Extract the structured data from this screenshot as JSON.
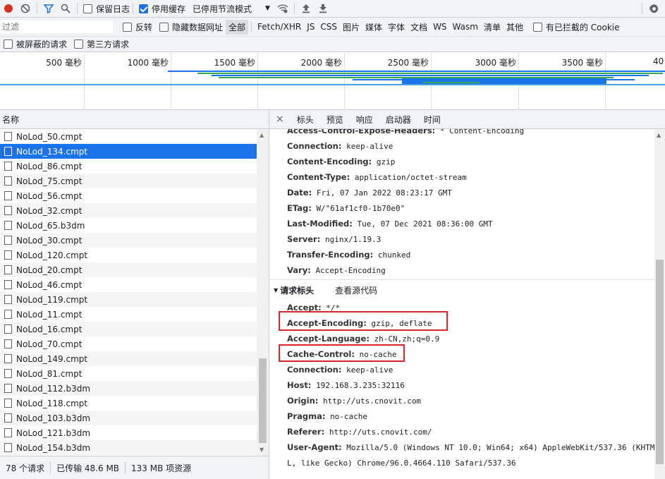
{
  "toolbar": {
    "preserve_log": "保留日志",
    "disable_cache": "停用缓存",
    "throttling": "已停用节流模式"
  },
  "filter": {
    "placeholder": "过滤",
    "invert": "反转",
    "hide_data_urls": "隐藏数据网址",
    "types": [
      "全部",
      "Fetch/XHR",
      "JS",
      "CSS",
      "图片",
      "媒体",
      "字体",
      "文档",
      "WS",
      "Wasm",
      "清单",
      "其他"
    ],
    "blocked_cookies": "有已拦截的 Cookie",
    "blocked_requests": "被屏蔽的请求",
    "third_party": "第三方请求"
  },
  "overview": {
    "ticks": [
      "500 毫秒",
      "1000 毫秒",
      "1500 毫秒",
      "2000 毫秒",
      "2500 毫秒",
      "3000 毫秒",
      "3500 毫秒",
      "40"
    ]
  },
  "list": {
    "header": "名称",
    "items": [
      "NoLod_50.cmpt",
      "NoLod_134.cmpt",
      "NoLod_86.cmpt",
      "NoLod_75.cmpt",
      "NoLod_56.cmpt",
      "NoLod_32.cmpt",
      "NoLod_65.b3dm",
      "NoLod_30.cmpt",
      "NoLod_120.cmpt",
      "NoLod_20.cmpt",
      "NoLod_46.cmpt",
      "NoLod_119.cmpt",
      "NoLod_11.cmpt",
      "NoLod_16.cmpt",
      "NoLod_70.cmpt",
      "NoLod_149.cmpt",
      "NoLod_81.cmpt",
      "NoLod_112.b3dm",
      "NoLod_118.cmpt",
      "NoLod_103.b3dm",
      "NoLod_121.b3dm",
      "NoLod_154.b3dm"
    ],
    "selected": "NoLod_134.cmpt"
  },
  "status": {
    "requests": "78 个请求",
    "transferred": "已传输 48.6 MB",
    "resources": "133 MB 项资源"
  },
  "detail_tabs": [
    "标头",
    "预览",
    "响应",
    "启动器",
    "时间"
  ],
  "response_headers": [
    {
      "key": "Access-Control-Expose-Headers:",
      "value": "* Content-Encoding"
    },
    {
      "key": "Connection:",
      "value": "keep-alive"
    },
    {
      "key": "Content-Encoding:",
      "value": "gzip"
    },
    {
      "key": "Content-Type:",
      "value": "application/octet-stream"
    },
    {
      "key": "Date:",
      "value": "Fri, 07 Jan 2022 08:23:17 GMT"
    },
    {
      "key": "ETag:",
      "value": "W/\"61af1cf0-1b70e0\""
    },
    {
      "key": "Last-Modified:",
      "value": "Tue, 07 Dec 2021 08:36:00 GMT"
    },
    {
      "key": "Server:",
      "value": "nginx/1.19.3"
    },
    {
      "key": "Transfer-Encoding:",
      "value": "chunked"
    },
    {
      "key": "Vary:",
      "value": "Accept-Encoding"
    }
  ],
  "request_section": {
    "title": "请求标头",
    "view_source": "查看源代码"
  },
  "request_headers": [
    {
      "key": "Accept:",
      "value": "*/*"
    },
    {
      "key": "Accept-Encoding:",
      "value": "gzip, deflate"
    },
    {
      "key": "Accept-Language:",
      "value": "zh-CN,zh;q=0.9"
    },
    {
      "key": "Cache-Control:",
      "value": "no-cache"
    },
    {
      "key": "Connection:",
      "value": "keep-alive"
    },
    {
      "key": "Host:",
      "value": "192.168.3.235:32116"
    },
    {
      "key": "Origin:",
      "value": "http://uts.cnovit.com"
    },
    {
      "key": "Pragma:",
      "value": "no-cache"
    },
    {
      "key": "Referer:",
      "value": "http://uts.cnovit.com/"
    },
    {
      "key": "User-Agent:",
      "value": "Mozilla/5.0 (Windows NT 10.0; Win64; x64) AppleWebKit/537.36 (KHTM"
    },
    {
      "key": "",
      "value": "L, like Gecko) Chrome/96.0.4664.110 Safari/537.36"
    }
  ],
  "colors": {
    "highlight": "#d9262b",
    "selected": "#1a73e8",
    "record": "#d93025",
    "waterfall_blue": "#1a73e8",
    "waterfall_green": "#34a853"
  }
}
